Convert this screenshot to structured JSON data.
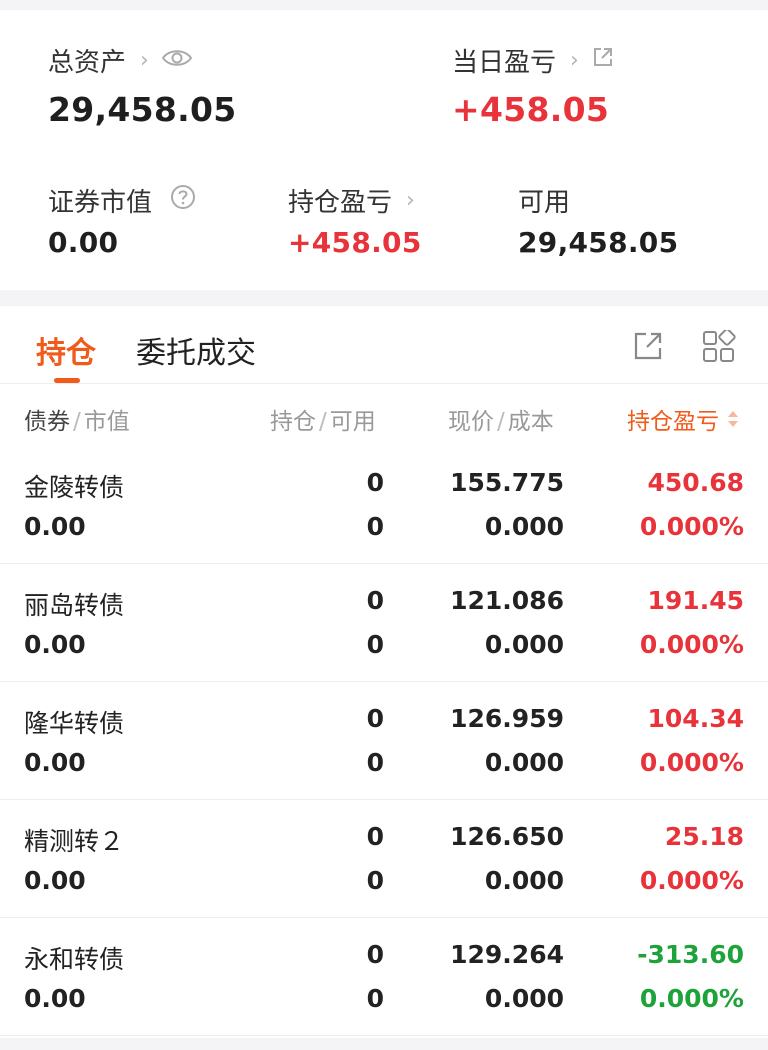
{
  "summary": {
    "total_assets_label": "总资产",
    "total_assets_value": "29,458.05",
    "daily_pnl_label": "当日盈亏",
    "daily_pnl_value": "+458.05",
    "securities_value_label": "证券市值",
    "securities_value": "0.00",
    "holding_pnl_label": "持仓盈亏",
    "holding_pnl_value": "+458.05",
    "available_label": "可用",
    "available_value": "29,458.05"
  },
  "tabs": [
    {
      "label": "持仓",
      "active": true
    },
    {
      "label": "委托成交",
      "active": false
    }
  ],
  "icons": {
    "eye": "eye-icon",
    "share_small": "share-icon",
    "help": "help-circle-icon",
    "export": "export-icon",
    "grid": "grid-view-icon"
  },
  "columns": {
    "bond": "债券",
    "market_value": "市值",
    "holding": "持仓",
    "available": "可用",
    "price": "现价",
    "cost": "成本",
    "pnl": "持仓盈亏"
  },
  "rows": [
    {
      "name": "金陵转债",
      "market_value": "0.00",
      "holding": "0",
      "available": "0",
      "price": "155.775",
      "cost": "0.000",
      "pnl": "450.68",
      "pnl_pct": "0.000%",
      "color": "#e8333a"
    },
    {
      "name": "丽岛转债",
      "market_value": "0.00",
      "holding": "0",
      "available": "0",
      "price": "121.086",
      "cost": "0.000",
      "pnl": "191.45",
      "pnl_pct": "0.000%",
      "color": "#e8333a"
    },
    {
      "name": "隆华转债",
      "market_value": "0.00",
      "holding": "0",
      "available": "0",
      "price": "126.959",
      "cost": "0.000",
      "pnl": "104.34",
      "pnl_pct": "0.000%",
      "color": "#e8333a"
    },
    {
      "name": "精测转２",
      "market_value": "0.00",
      "holding": "0",
      "available": "0",
      "price": "126.650",
      "cost": "0.000",
      "pnl": "25.18",
      "pnl_pct": "0.000%",
      "color": "#e8333a"
    },
    {
      "name": "永和转债",
      "market_value": "0.00",
      "holding": "0",
      "available": "0",
      "price": "129.264",
      "cost": "0.000",
      "pnl": "-313.60",
      "pnl_pct": "0.000%",
      "color": "#1ea33a"
    }
  ],
  "colors": {
    "accent": "#f05a1a",
    "up": "#e8333a",
    "down": "#1ea33a"
  }
}
